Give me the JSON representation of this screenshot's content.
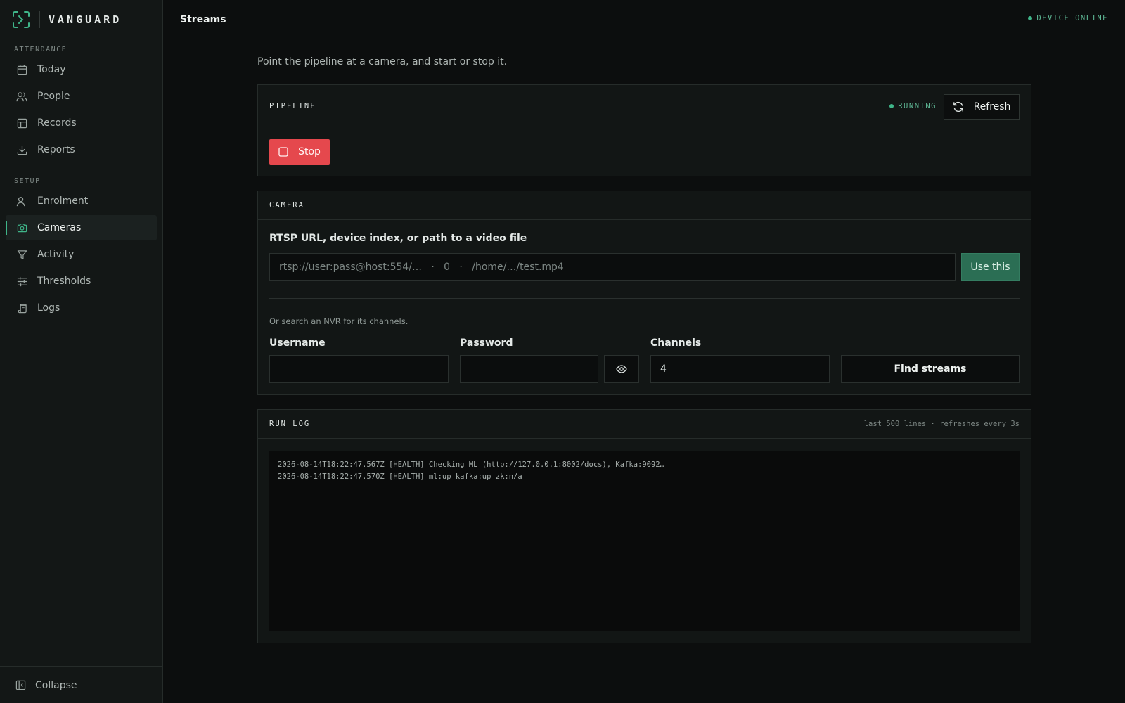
{
  "brand": {
    "name": "VANGUARD"
  },
  "sidebar": {
    "sections": [
      {
        "label": "ATTENDANCE",
        "items": [
          {
            "label": "Today",
            "icon": "calendar-icon"
          },
          {
            "label": "People",
            "icon": "users-icon"
          },
          {
            "label": "Records",
            "icon": "table-icon"
          },
          {
            "label": "Reports",
            "icon": "download-icon"
          }
        ]
      },
      {
        "label": "SETUP",
        "items": [
          {
            "label": "Enrolment",
            "icon": "user-icon"
          },
          {
            "label": "Cameras",
            "icon": "camera-icon",
            "active": true
          },
          {
            "label": "Activity",
            "icon": "filter-icon"
          },
          {
            "label": "Thresholds",
            "icon": "sliders-icon"
          },
          {
            "label": "Logs",
            "icon": "scroll-icon"
          }
        ]
      }
    ],
    "collapse_label": "Collapse"
  },
  "header": {
    "title": "Streams",
    "device_status": "DEVICE ONLINE"
  },
  "main": {
    "intro": "Point the pipeline at a camera, and start or stop it.",
    "pipeline": {
      "title": "PIPELINE",
      "status": "RUNNING",
      "refresh_label": "Refresh",
      "stop_label": "Stop"
    },
    "camera": {
      "title": "CAMERA",
      "source_label": "RTSP URL, device index, or path to a video file",
      "source_placeholder": "rtsp://user:pass@host:554/…   ·   0   ·   /home/…/test.mp4",
      "source_value": "",
      "use_label": "Use this",
      "nvr_hint": "Or search an NVR for its channels.",
      "username_label": "Username",
      "username_value": "",
      "password_label": "Password",
      "password_value": "",
      "channels_label": "Channels",
      "channels_value": "4",
      "find_label": "Find streams"
    },
    "run_log": {
      "title": "RUN LOG",
      "meta": "last 500 lines · refreshes every 3s",
      "lines": [
        "2026-08-14T18:22:47.567Z [HEALTH] Checking ML (http://127.0.0.1:8002/docs), Kafka:9092…",
        "2026-08-14T18:22:47.570Z [HEALTH] ml:up kafka:up zk:n/a"
      ]
    }
  },
  "colors": {
    "accent": "#3fb589",
    "danger": "#e5484d",
    "primary_button": "#2b6e54"
  }
}
